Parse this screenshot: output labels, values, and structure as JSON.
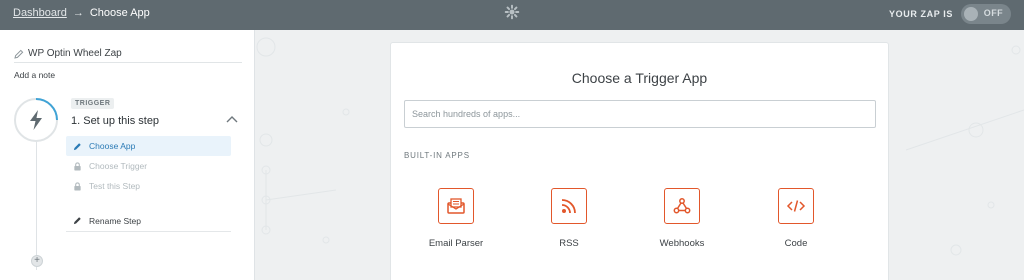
{
  "breadcrumb": {
    "home": "Dashboard",
    "separator": "→",
    "current": "Choose App"
  },
  "header": {
    "status_label": "YOUR ZAP IS",
    "toggle_state": "OFF"
  },
  "sidebar": {
    "zap_name": "WP Optin Wheel Zap",
    "add_note": "Add a note",
    "step": {
      "badge": "TRIGGER",
      "title": "1. Set up this step",
      "substeps": [
        {
          "label": "Choose App",
          "icon": "pencil-icon",
          "state": "active"
        },
        {
          "label": "Choose Trigger",
          "icon": "lock-icon",
          "state": "locked"
        },
        {
          "label": "Test this Step",
          "icon": "lock-icon",
          "state": "locked"
        }
      ],
      "rename": "Rename Step"
    },
    "add_step": "+"
  },
  "main": {
    "title": "Choose a Trigger App",
    "search_placeholder": "Search hundreds of apps...",
    "section_label": "BUILT-IN APPS",
    "apps": [
      {
        "label": "Email Parser",
        "icon": "email-parser-icon"
      },
      {
        "label": "RSS",
        "icon": "rss-icon"
      },
      {
        "label": "Webhooks",
        "icon": "webhooks-icon"
      },
      {
        "label": "Code",
        "icon": "code-icon"
      }
    ]
  },
  "colors": {
    "topbar": "#5f6a70",
    "accent_orange": "#e2572b",
    "active_blue": "#2a7ab5",
    "background": "#eef0f1"
  }
}
